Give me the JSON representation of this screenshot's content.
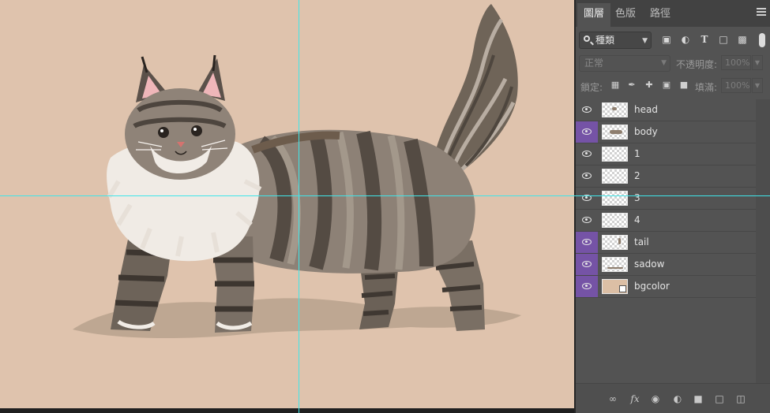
{
  "panel": {
    "tabs": [
      {
        "label": "圖層",
        "active": true
      },
      {
        "label": "色版",
        "active": false
      },
      {
        "label": "路徑",
        "active": false
      }
    ],
    "filter": {
      "selected": "種類"
    },
    "blend_mode": "正常",
    "opacity_label": "不透明度:",
    "opacity_value": "100%",
    "lock_label": "鎖定:",
    "fill_label": "填滿:",
    "fill_value": "100%",
    "layers": [
      {
        "name": "head",
        "selected": false,
        "visible": true,
        "thumbnail": "transparent-with-content"
      },
      {
        "name": "body",
        "selected": true,
        "visible": true,
        "thumbnail": "transparent-with-content"
      },
      {
        "name": "1",
        "selected": false,
        "visible": true,
        "thumbnail": "transparent"
      },
      {
        "name": "2",
        "selected": false,
        "visible": true,
        "thumbnail": "transparent"
      },
      {
        "name": "3",
        "selected": false,
        "visible": true,
        "thumbnail": "transparent"
      },
      {
        "name": "4",
        "selected": false,
        "visible": true,
        "thumbnail": "transparent"
      },
      {
        "name": "tail",
        "selected": true,
        "visible": true,
        "thumbnail": "transparent"
      },
      {
        "name": "sadow",
        "selected": true,
        "visible": true,
        "thumbnail": "transparent"
      },
      {
        "name": "bgcolor",
        "selected": true,
        "visible": true,
        "thumbnail": "color-fill"
      }
    ],
    "footer_icons": [
      "link-icon",
      "fx-icon",
      "mask-icon",
      "adjustment-icon",
      "folder-icon",
      "new-layer-icon",
      "trash-icon"
    ]
  },
  "canvas": {
    "background_color": "#dfc3ad",
    "artwork": "illustration of a long-haired tabby cat standing with its tail raised",
    "guides": [
      "vertical",
      "horizontal"
    ]
  },
  "colors": {
    "panel_bg": "#535353",
    "tab_bar_bg": "#424242",
    "selection_accent": "#7553a6",
    "guide": "#3fe6ea"
  }
}
